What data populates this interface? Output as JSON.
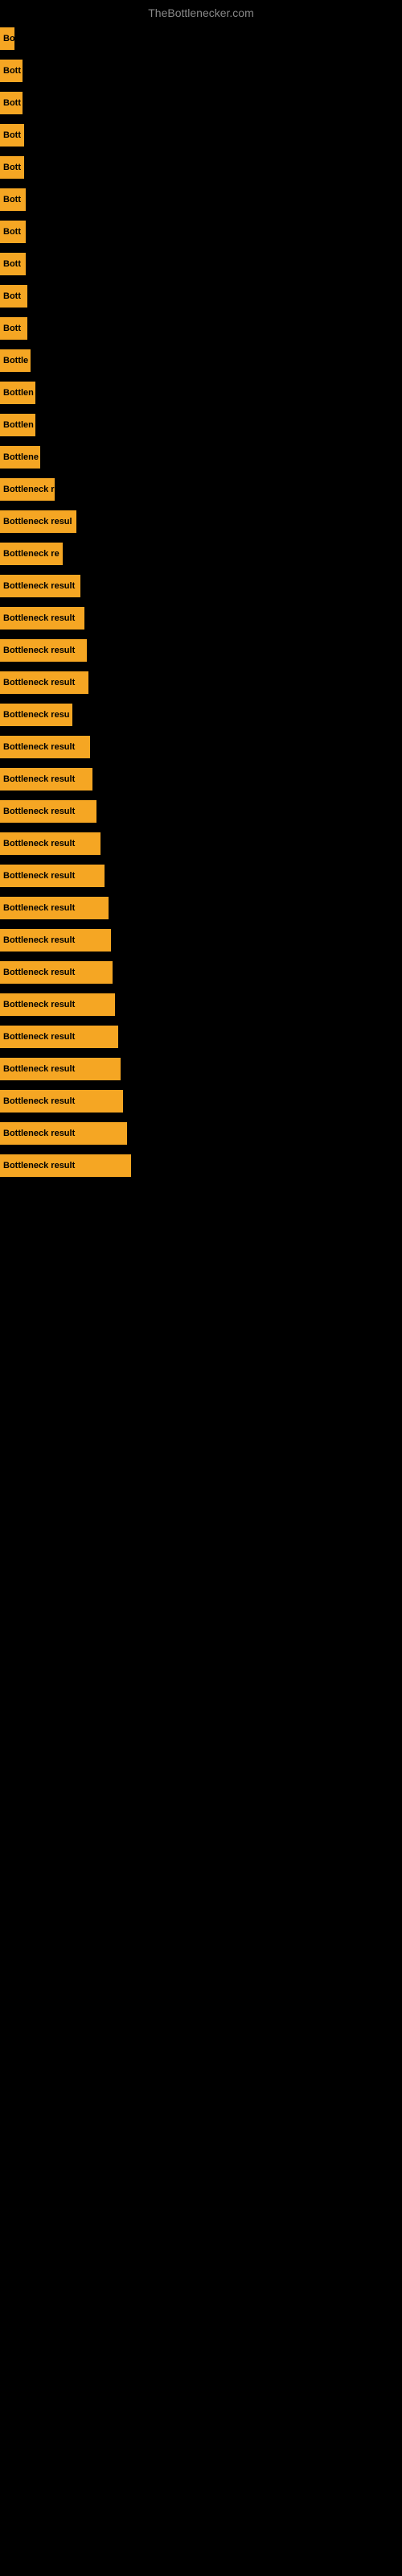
{
  "title": "TheBottlenecker.com",
  "bars": [
    {
      "label": "Bo",
      "width": 18,
      "text": "Bo"
    },
    {
      "label": "Bott",
      "width": 28,
      "text": "Bott"
    },
    {
      "label": "Bott",
      "width": 28,
      "text": "Bott"
    },
    {
      "label": "Bott",
      "width": 30,
      "text": "Bott"
    },
    {
      "label": "Bott",
      "width": 30,
      "text": "Bott"
    },
    {
      "label": "Bott",
      "width": 32,
      "text": "Bott"
    },
    {
      "label": "Bott",
      "width": 32,
      "text": "Bott"
    },
    {
      "label": "Bott",
      "width": 32,
      "text": "Bott"
    },
    {
      "label": "Bott",
      "width": 34,
      "text": "Bott"
    },
    {
      "label": "Bott",
      "width": 34,
      "text": "Bott"
    },
    {
      "label": "Bottle",
      "width": 38,
      "text": "Bottle"
    },
    {
      "label": "Bottlen",
      "width": 44,
      "text": "Bottlen"
    },
    {
      "label": "Bottlen",
      "width": 44,
      "text": "Bottlen"
    },
    {
      "label": "Bottlene",
      "width": 50,
      "text": "Bottlene"
    },
    {
      "label": "Bottleneck r",
      "width": 68,
      "text": "Bottleneck r"
    },
    {
      "label": "Bottleneck resul",
      "width": 95,
      "text": "Bottleneck resul"
    },
    {
      "label": "Bottleneck re",
      "width": 78,
      "text": "Bottleneck re"
    },
    {
      "label": "Bottleneck result",
      "width": 100,
      "text": "Bottleneck result"
    },
    {
      "label": "Bottleneck result",
      "width": 105,
      "text": "Bottleneck result"
    },
    {
      "label": "Bottleneck result",
      "width": 108,
      "text": "Bottleneck result"
    },
    {
      "label": "Bottleneck result",
      "width": 110,
      "text": "Bottleneck result"
    },
    {
      "label": "Bottleneck resu",
      "width": 90,
      "text": "Bottleneck resu"
    },
    {
      "label": "Bottleneck result",
      "width": 112,
      "text": "Bottleneck result"
    },
    {
      "label": "Bottleneck result",
      "width": 115,
      "text": "Bottleneck result"
    },
    {
      "label": "Bottleneck result",
      "width": 120,
      "text": "Bottleneck result"
    },
    {
      "label": "Bottleneck result",
      "width": 125,
      "text": "Bottleneck result"
    },
    {
      "label": "Bottleneck result",
      "width": 130,
      "text": "Bottleneck result"
    },
    {
      "label": "Bottleneck result",
      "width": 135,
      "text": "Bottleneck result"
    },
    {
      "label": "Bottleneck result",
      "width": 138,
      "text": "Bottleneck result"
    },
    {
      "label": "Bottleneck result",
      "width": 140,
      "text": "Bottleneck result"
    },
    {
      "label": "Bottleneck result",
      "width": 143,
      "text": "Bottleneck result"
    },
    {
      "label": "Bottleneck result",
      "width": 147,
      "text": "Bottleneck result"
    },
    {
      "label": "Bottleneck result",
      "width": 150,
      "text": "Bottleneck result"
    },
    {
      "label": "Bottleneck result",
      "width": 153,
      "text": "Bottleneck result"
    },
    {
      "label": "Bottleneck result",
      "width": 158,
      "text": "Bottleneck result"
    },
    {
      "label": "Bottleneck result",
      "width": 163,
      "text": "Bottleneck result"
    }
  ]
}
